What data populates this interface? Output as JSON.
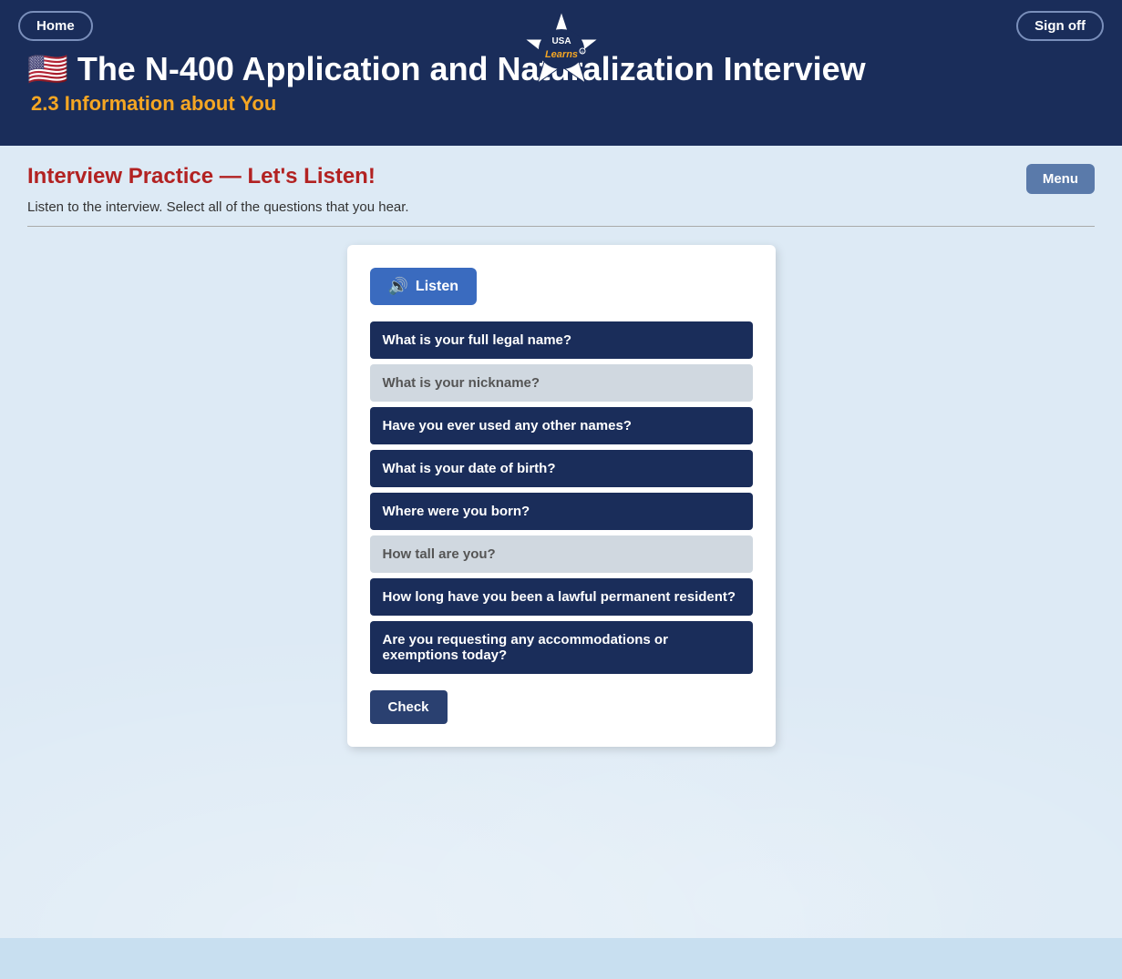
{
  "header": {
    "home_label": "Home",
    "signoff_label": "Sign off",
    "title_icon": "🇺🇸",
    "title": "The N-400 Application and Naturalization Interview",
    "subtitle": "2.3 Information about You"
  },
  "section": {
    "title": "Interview Practice — Let's Listen!",
    "description": "Listen to the interview. Select all of the questions that you hear.",
    "menu_label": "Menu"
  },
  "card": {
    "listen_label": "Listen",
    "questions": [
      {
        "id": "q1",
        "text": "What is your full legal name?",
        "selected": true
      },
      {
        "id": "q2",
        "text": "What is your nickname?",
        "selected": false
      },
      {
        "id": "q3",
        "text": "Have you ever used any other names?",
        "selected": true
      },
      {
        "id": "q4",
        "text": "What is your date of birth?",
        "selected": true
      },
      {
        "id": "q5",
        "text": "Where were you born?",
        "selected": true
      },
      {
        "id": "q6",
        "text": "How tall are you?",
        "selected": false
      },
      {
        "id": "q7",
        "text": "How long have you been a lawful permanent resident?",
        "selected": true
      },
      {
        "id": "q8",
        "text": "Are you requesting any accommodations or exemptions today?",
        "selected": true
      }
    ],
    "check_label": "Check"
  }
}
